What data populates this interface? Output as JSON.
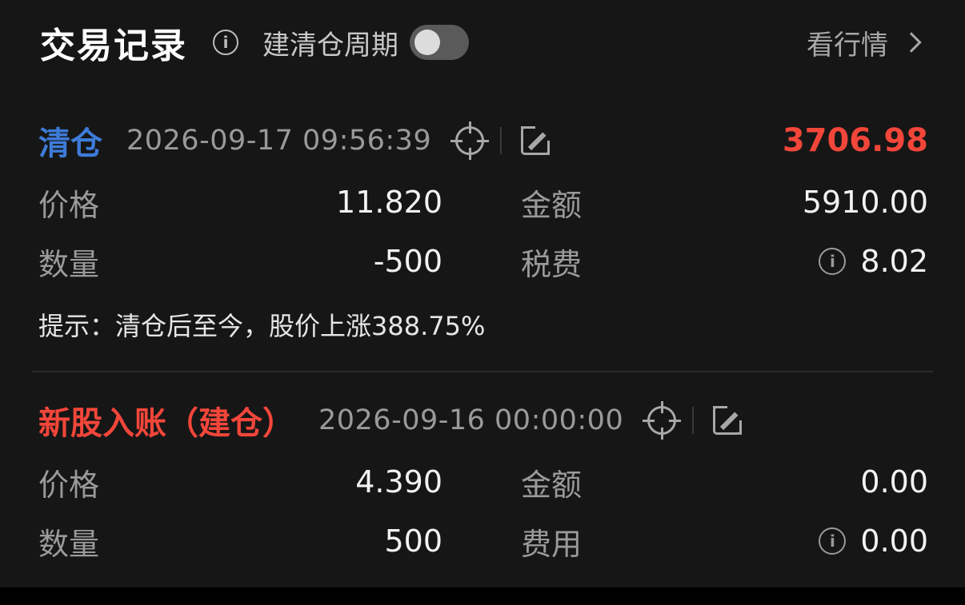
{
  "header": {
    "title": "交易记录",
    "cycle_label": "建清仓周期",
    "cycle_toggle_on": false,
    "market_link": "看行情"
  },
  "records": [
    {
      "type": "清仓",
      "type_color": "#3d7bd8",
      "time": "2026-09-17 09:56:39",
      "amount": "3706.98",
      "price_label": "价格",
      "price": "11.820",
      "total_label": "金额",
      "total": "5910.00",
      "qty_label": "数量",
      "qty": "-500",
      "fee_label": "税费",
      "fee": "8.02",
      "tip": "提示：清仓后至今，股价上涨388.75%"
    },
    {
      "type": "新股入账（建仓）",
      "type_color": "#f2463a",
      "time": "2026-09-16 00:00:00",
      "price_label": "价格",
      "price": "4.390",
      "total_label": "金额",
      "total": "0.00",
      "qty_label": "数量",
      "qty": "500",
      "fee_label": "费用",
      "fee": "0.00"
    }
  ],
  "icons": {
    "info": "info-icon",
    "locate": "target-icon",
    "edit": "edit-icon",
    "chevron": "chevron-right-icon"
  }
}
